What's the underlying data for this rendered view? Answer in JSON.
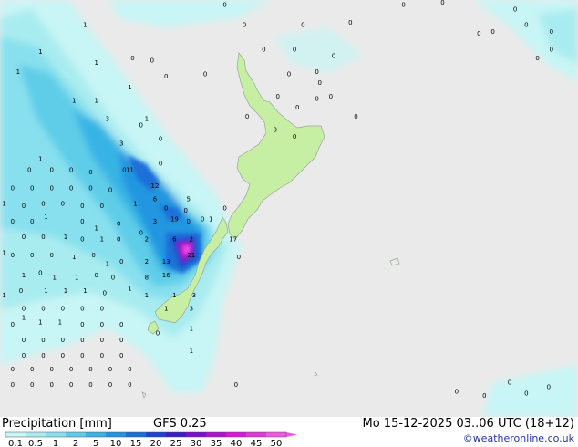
{
  "header": {
    "title": "Precipitation [mm]",
    "model": "GFS 0.25",
    "valid_time": "Mo 15-12-2025 03..06 UTC (18+12)",
    "credit": "©weatheronline.co.uk"
  },
  "legend": {
    "labels": [
      "0.1",
      "0.5",
      "1",
      "2",
      "5",
      "10",
      "15",
      "20",
      "25",
      "30",
      "35",
      "40",
      "45",
      "50"
    ],
    "colors": [
      "#c8f5f5",
      "#a9ecf0",
      "#88e0ee",
      "#5fcde8",
      "#37b4e4",
      "#2196e0",
      "#1a70d8",
      "#1a44cc",
      "#3a1ec0",
      "#7a10c8",
      "#b010d0",
      "#d41ad8",
      "#e038d8",
      "#f058e4"
    ]
  },
  "map": {
    "ocean_color": "#eaeaea",
    "land_color": "#c6efa4",
    "precip_values": [
      {
        "v": "1",
        "lon": 172.55,
        "lat": -31.75
      },
      {
        "v": "1",
        "lon": 170.95,
        "lat": -32.95
      },
      {
        "v": "1",
        "lon": 170.15,
        "lat": -33.85
      },
      {
        "v": "1",
        "lon": 172.95,
        "lat": -33.45
      },
      {
        "v": "1",
        "lon": 174.15,
        "lat": -34.55
      },
      {
        "v": "1",
        "lon": 172.15,
        "lat": -35.15
      },
      {
        "v": "1",
        "lon": 172.95,
        "lat": -35.15
      },
      {
        "v": "1",
        "lon": 174.75,
        "lat": -35.95
      },
      {
        "v": "3",
        "lon": 173.35,
        "lat": -35.95
      },
      {
        "v": "3",
        "lon": 173.85,
        "lat": -37.05
      },
      {
        "v": "11",
        "lon": 174.15,
        "lat": -38.25
      },
      {
        "v": "12",
        "lon": 175.05,
        "lat": -38.95
      },
      {
        "v": "1",
        "lon": 174.35,
        "lat": -39.75
      },
      {
        "v": "6",
        "lon": 175.05,
        "lat": -39.55
      },
      {
        "v": "5",
        "lon": 176.25,
        "lat": -39.55
      },
      {
        "v": "19",
        "lon": 175.75,
        "lat": -40.45
      },
      {
        "v": "3",
        "lon": 175.05,
        "lat": -40.55
      },
      {
        "v": "1",
        "lon": 177.05,
        "lat": -40.45
      },
      {
        "v": "1",
        "lon": 172.95,
        "lat": -40.85
      },
      {
        "v": "1",
        "lon": 173.15,
        "lat": -41.35
      },
      {
        "v": "2",
        "lon": 174.75,
        "lat": -41.35
      },
      {
        "v": "6",
        "lon": 175.75,
        "lat": -41.35
      },
      {
        "v": "2",
        "lon": 176.35,
        "lat": -41.35
      },
      {
        "v": "17",
        "lon": 177.85,
        "lat": -41.35
      },
      {
        "v": "21",
        "lon": 176.35,
        "lat": -42.05
      },
      {
        "v": "2",
        "lon": 174.75,
        "lat": -42.35
      },
      {
        "v": "13",
        "lon": 175.45,
        "lat": -42.35
      },
      {
        "v": "1",
        "lon": 173.35,
        "lat": -42.45
      },
      {
        "v": "8",
        "lon": 174.75,
        "lat": -43.05
      },
      {
        "v": "16",
        "lon": 175.45,
        "lat": -42.95
      },
      {
        "v": "1",
        "lon": 174.15,
        "lat": -43.55
      },
      {
        "v": "1",
        "lon": 174.75,
        "lat": -43.85
      },
      {
        "v": "1",
        "lon": 175.75,
        "lat": -43.85
      },
      {
        "v": "3",
        "lon": 176.45,
        "lat": -43.85
      },
      {
        "v": "1",
        "lon": 175.45,
        "lat": -44.45
      },
      {
        "v": "3",
        "lon": 176.35,
        "lat": -44.45
      },
      {
        "v": "1",
        "lon": 176.35,
        "lat": -45.35
      },
      {
        "v": "1",
        "lon": 176.35,
        "lat": -46.35
      },
      {
        "v": "1",
        "lon": 170.95,
        "lat": -37.75
      },
      {
        "v": "1",
        "lon": 169.65,
        "lat": -39.75
      },
      {
        "v": "1",
        "lon": 169.65,
        "lat": -41.95
      },
      {
        "v": "1",
        "lon": 170.35,
        "lat": -42.95
      },
      {
        "v": "1",
        "lon": 169.65,
        "lat": -43.85
      },
      {
        "v": "1",
        "lon": 170.35,
        "lat": -44.85
      },
      {
        "v": "1",
        "lon": 171.15,
        "lat": -40.35
      },
      {
        "v": "1",
        "lon": 171.85,
        "lat": -41.25
      },
      {
        "v": "1",
        "lon": 172.15,
        "lat": -42.15
      },
      {
        "v": "1",
        "lon": 171.45,
        "lat": -43.05
      },
      {
        "v": "1",
        "lon": 172.25,
        "lat": -43.05
      },
      {
        "v": "1",
        "lon": 171.15,
        "lat": -43.65
      },
      {
        "v": "1",
        "lon": 171.85,
        "lat": -43.65
      },
      {
        "v": "1",
        "lon": 172.55,
        "lat": -43.65
      },
      {
        "v": "1",
        "lon": 170.95,
        "lat": -45.05
      },
      {
        "v": "1",
        "lon": 171.65,
        "lat": -45.05
      },
      {
        "v": "0",
        "lon": 173.95,
        "lat": -38.25
      },
      {
        "v": "0",
        "lon": 176.25,
        "lat": -40.55
      },
      {
        "v": "0",
        "lon": 178.05,
        "lat": -42.15
      },
      {
        "v": "0",
        "lon": 174.25,
        "lat": -33.25
      },
      {
        "v": "0",
        "lon": 175.45,
        "lat": -34.05
      },
      {
        "v": "0",
        "lon": 174.55,
        "lat": -36.25
      },
      {
        "v": "0",
        "lon": 175.25,
        "lat": -36.85
      },
      {
        "v": "0",
        "lon": 175.25,
        "lat": -37.95
      },
      {
        "v": "0",
        "lon": 175.45,
        "lat": -39.95
      },
      {
        "v": "0",
        "lon": 176.15,
        "lat": -40.05
      },
      {
        "v": "0",
        "lon": 177.55,
        "lat": -39.95
      },
      {
        "v": "0",
        "lon": 174.55,
        "lat": -41.05
      },
      {
        "v": "0",
        "lon": 176.75,
        "lat": -40.45
      },
      {
        "v": "0",
        "lon": 173.85,
        "lat": -42.35
      },
      {
        "v": "0",
        "lon": 173.55,
        "lat": -43.05
      },
      {
        "v": "0",
        "lon": 170.55,
        "lat": -38.25
      },
      {
        "v": "0",
        "lon": 171.35,
        "lat": -38.25
      },
      {
        "v": "0",
        "lon": 172.05,
        "lat": -38.25
      },
      {
        "v": "0",
        "lon": 172.75,
        "lat": -38.35
      },
      {
        "v": "0",
        "lon": 169.95,
        "lat": -39.05
      },
      {
        "v": "0",
        "lon": 170.65,
        "lat": -39.05
      },
      {
        "v": "0",
        "lon": 171.35,
        "lat": -39.05
      },
      {
        "v": "0",
        "lon": 172.05,
        "lat": -39.05
      },
      {
        "v": "0",
        "lon": 172.75,
        "lat": -39.05
      },
      {
        "v": "0",
        "lon": 173.45,
        "lat": -39.15
      },
      {
        "v": "0",
        "lon": 170.35,
        "lat": -39.85
      },
      {
        "v": "0",
        "lon": 171.05,
        "lat": -39.75
      },
      {
        "v": "0",
        "lon": 171.75,
        "lat": -39.75
      },
      {
        "v": "0",
        "lon": 172.45,
        "lat": -39.85
      },
      {
        "v": "0",
        "lon": 173.15,
        "lat": -39.85
      },
      {
        "v": "0",
        "lon": 169.95,
        "lat": -40.55
      },
      {
        "v": "0",
        "lon": 170.65,
        "lat": -40.55
      },
      {
        "v": "0",
        "lon": 172.45,
        "lat": -40.55
      },
      {
        "v": "0",
        "lon": 173.75,
        "lat": -40.65
      },
      {
        "v": "0",
        "lon": 170.35,
        "lat": -41.25
      },
      {
        "v": "0",
        "lon": 171.05,
        "lat": -41.25
      },
      {
        "v": "0",
        "lon": 172.45,
        "lat": -41.35
      },
      {
        "v": "0",
        "lon": 173.75,
        "lat": -41.35
      },
      {
        "v": "0",
        "lon": 169.95,
        "lat": -42.05
      },
      {
        "v": "0",
        "lon": 170.65,
        "lat": -42.05
      },
      {
        "v": "0",
        "lon": 171.35,
        "lat": -42.05
      },
      {
        "v": "0",
        "lon": 172.85,
        "lat": -42.05
      },
      {
        "v": "0",
        "lon": 170.95,
        "lat": -42.85
      },
      {
        "v": "0",
        "lon": 172.95,
        "lat": -42.95
      },
      {
        "v": "0",
        "lon": 170.25,
        "lat": -43.65
      },
      {
        "v": "0",
        "lon": 173.25,
        "lat": -43.75
      },
      {
        "v": "0",
        "lon": 170.35,
        "lat": -44.45
      },
      {
        "v": "0",
        "lon": 171.05,
        "lat": -44.45
      },
      {
        "v": "0",
        "lon": 171.75,
        "lat": -44.45
      },
      {
        "v": "0",
        "lon": 172.45,
        "lat": -44.45
      },
      {
        "v": "0",
        "lon": 173.15,
        "lat": -44.45
      },
      {
        "v": "0",
        "lon": 169.95,
        "lat": -45.15
      },
      {
        "v": "0",
        "lon": 172.45,
        "lat": -45.15
      },
      {
        "v": "0",
        "lon": 173.15,
        "lat": -45.15
      },
      {
        "v": "0",
        "lon": 173.85,
        "lat": -45.15
      },
      {
        "v": "0",
        "lon": 170.35,
        "lat": -45.85
      },
      {
        "v": "0",
        "lon": 171.05,
        "lat": -45.85
      },
      {
        "v": "0",
        "lon": 171.75,
        "lat": -45.85
      },
      {
        "v": "0",
        "lon": 172.45,
        "lat": -45.85
      },
      {
        "v": "0",
        "lon": 173.15,
        "lat": -45.85
      },
      {
        "v": "0",
        "lon": 173.85,
        "lat": -45.85
      },
      {
        "v": "0",
        "lon": 175.15,
        "lat": -45.55
      },
      {
        "v": "0",
        "lon": 170.35,
        "lat": -46.55
      },
      {
        "v": "0",
        "lon": 171.05,
        "lat": -46.55
      },
      {
        "v": "0",
        "lon": 171.75,
        "lat": -46.55
      },
      {
        "v": "0",
        "lon": 172.45,
        "lat": -46.55
      },
      {
        "v": "0",
        "lon": 173.15,
        "lat": -46.55
      },
      {
        "v": "0",
        "lon": 173.85,
        "lat": -46.55
      },
      {
        "v": "0",
        "lon": 169.95,
        "lat": -47.15
      },
      {
        "v": "0",
        "lon": 170.65,
        "lat": -47.15
      },
      {
        "v": "0",
        "lon": 171.35,
        "lat": -47.15
      },
      {
        "v": "0",
        "lon": 172.05,
        "lat": -47.15
      },
      {
        "v": "0",
        "lon": 172.75,
        "lat": -47.15
      },
      {
        "v": "0",
        "lon": 173.45,
        "lat": -47.15
      },
      {
        "v": "0",
        "lon": 174.15,
        "lat": -47.15
      },
      {
        "v": "0",
        "lon": 169.95,
        "lat": -47.85
      },
      {
        "v": "0",
        "lon": 170.65,
        "lat": -47.85
      },
      {
        "v": "0",
        "lon": 171.35,
        "lat": -47.85
      },
      {
        "v": "0",
        "lon": 172.05,
        "lat": -47.85
      },
      {
        "v": "0",
        "lon": 172.75,
        "lat": -47.85
      },
      {
        "v": "0",
        "lon": 173.45,
        "lat": -47.85
      },
      {
        "v": "0",
        "lon": 174.15,
        "lat": -47.85
      },
      {
        "v": "0",
        "lon": 177.95,
        "lat": -47.85
      },
      {
        "v": "0",
        "lon": 185.85,
        "lat": -48.15
      },
      {
        "v": "0",
        "lon": 186.85,
        "lat": -48.35
      },
      {
        "v": "0",
        "lon": 187.75,
        "lat": -47.75
      },
      {
        "v": "0",
        "lon": 188.35,
        "lat": -48.25
      },
      {
        "v": "0",
        "lon": 189.15,
        "lat": -47.95
      },
      {
        "v": "0",
        "lon": 174.95,
        "lat": -33.35
      },
      {
        "v": "0",
        "lon": 176.85,
        "lat": -33.95
      },
      {
        "v": "0",
        "lon": 178.25,
        "lat": -31.75
      },
      {
        "v": "0",
        "lon": 178.95,
        "lat": -32.85
      },
      {
        "v": "0",
        "lon": 179.85,
        "lat": -33.95
      },
      {
        "v": "0",
        "lon": 180.05,
        "lat": -32.85
      },
      {
        "v": "0",
        "lon": 180.35,
        "lat": -31.75
      },
      {
        "v": "0",
        "lon": 180.85,
        "lat": -33.85
      },
      {
        "v": "0",
        "lon": 180.95,
        "lat": -34.35
      },
      {
        "v": "0",
        "lon": 181.45,
        "lat": -33.15
      },
      {
        "v": "0",
        "lon": 181.35,
        "lat": -34.95
      },
      {
        "v": "0",
        "lon": 179.45,
        "lat": -34.95
      },
      {
        "v": "0",
        "lon": 180.15,
        "lat": -35.45
      },
      {
        "v": "0",
        "lon": 180.85,
        "lat": -35.05
      },
      {
        "v": "0",
        "lon": 182.25,
        "lat": -35.85
      },
      {
        "v": "0",
        "lon": 179.35,
        "lat": -36.45
      },
      {
        "v": "0",
        "lon": 180.05,
        "lat": -36.75
      },
      {
        "v": "0",
        "lon": 178.35,
        "lat": -35.85
      },
      {
        "v": "0",
        "lon": 183.95,
        "lat": -30.85
      },
      {
        "v": "0",
        "lon": 182.05,
        "lat": -31.65
      },
      {
        "v": "0",
        "lon": 185.35,
        "lat": -30.75
      },
      {
        "v": "0",
        "lon": 187.95,
        "lat": -31.05
      },
      {
        "v": "0",
        "lon": 188.35,
        "lat": -31.75
      },
      {
        "v": "0",
        "lon": 187.15,
        "lat": -32.05
      },
      {
        "v": "0",
        "lon": 189.25,
        "lat": -32.05
      },
      {
        "v": "0",
        "lon": 189.25,
        "lat": -32.85
      },
      {
        "v": "0",
        "lon": 188.75,
        "lat": -33.25
      },
      {
        "v": "0",
        "lon": 186.65,
        "lat": -32.15
      },
      {
        "v": "0",
        "lon": 177.55,
        "lat": -30.85
      }
    ]
  }
}
